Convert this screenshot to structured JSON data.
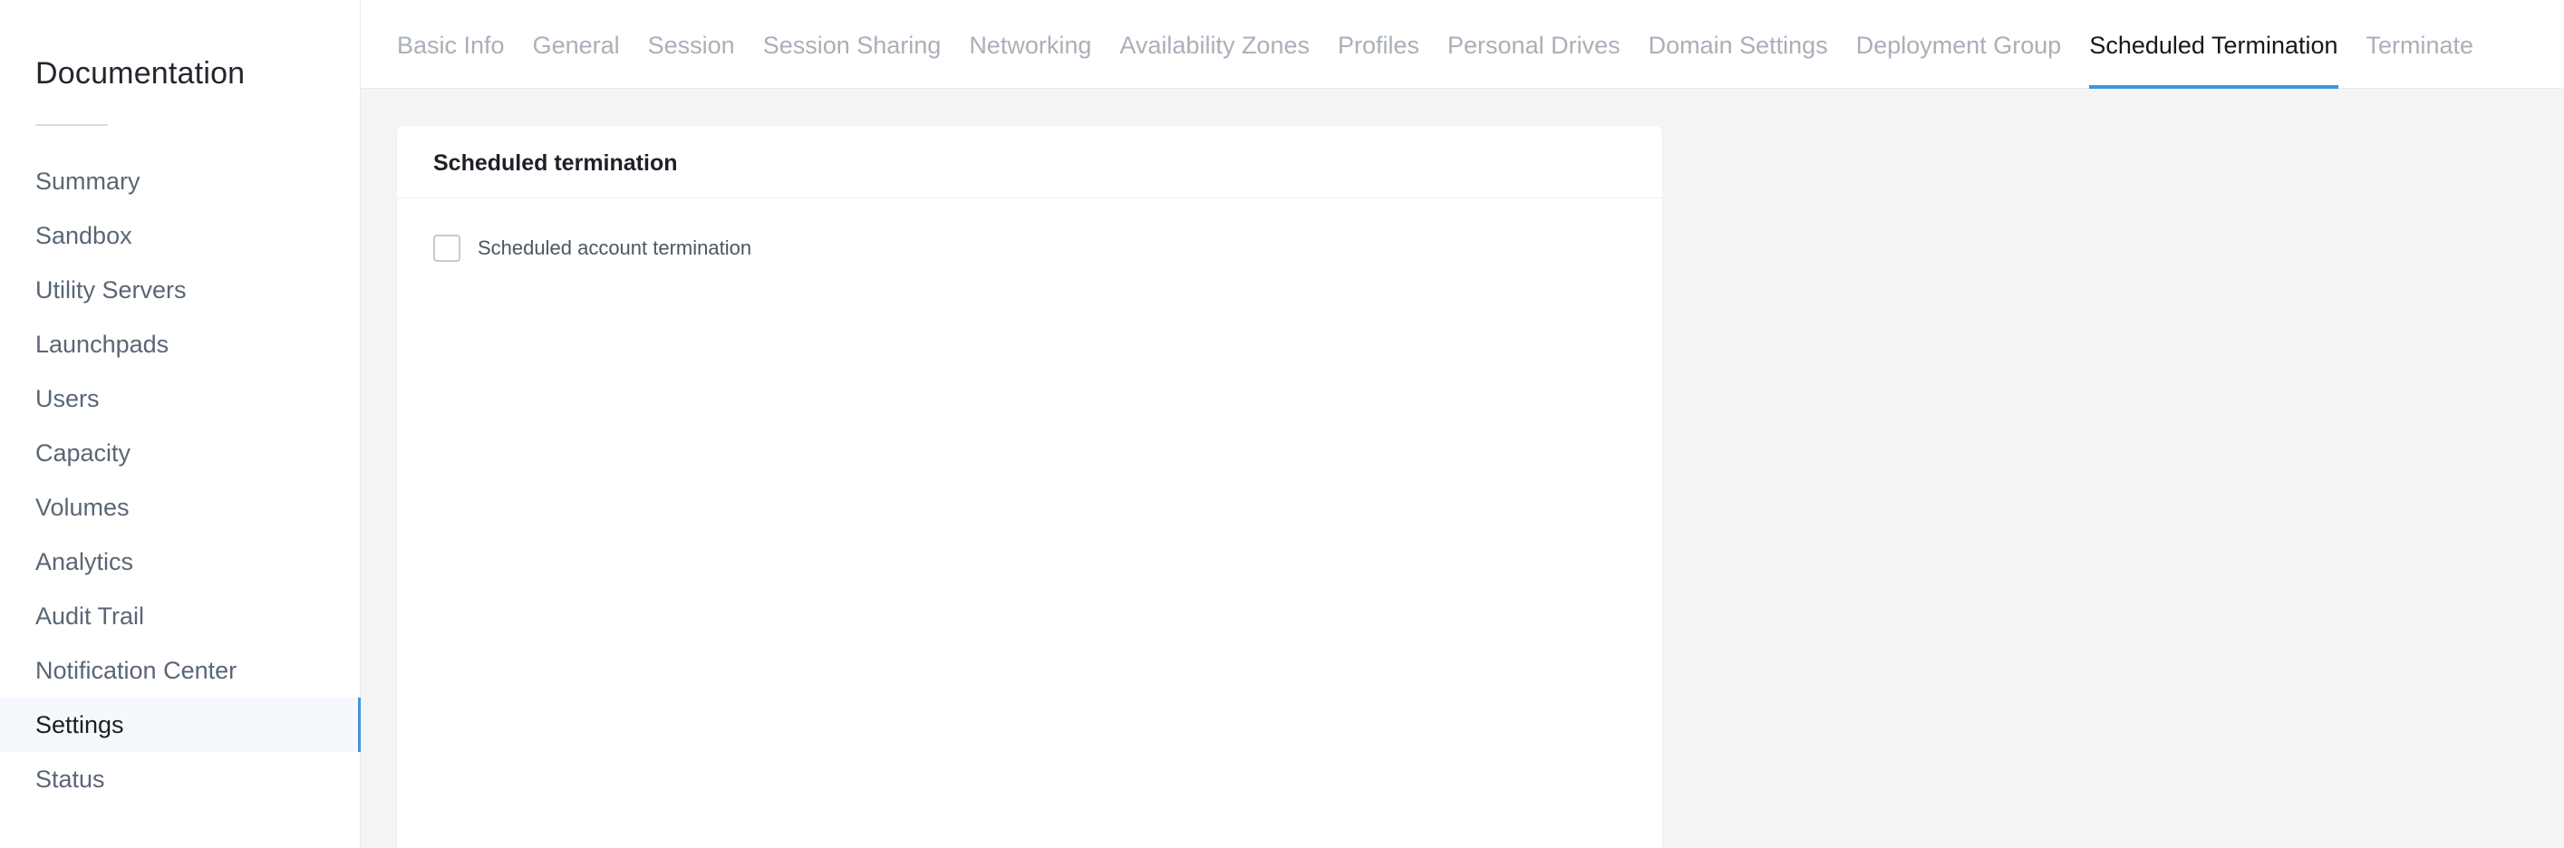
{
  "sidebar": {
    "title": "Documentation",
    "items": [
      {
        "label": "Summary",
        "active": false
      },
      {
        "label": "Sandbox",
        "active": false
      },
      {
        "label": "Utility Servers",
        "active": false
      },
      {
        "label": "Launchpads",
        "active": false
      },
      {
        "label": "Users",
        "active": false
      },
      {
        "label": "Capacity",
        "active": false
      },
      {
        "label": "Volumes",
        "active": false
      },
      {
        "label": "Analytics",
        "active": false
      },
      {
        "label": "Audit Trail",
        "active": false
      },
      {
        "label": "Notification Center",
        "active": false
      },
      {
        "label": "Settings",
        "active": true
      },
      {
        "label": "Status",
        "active": false
      }
    ]
  },
  "tabs": [
    {
      "label": "Basic Info",
      "active": false
    },
    {
      "label": "General",
      "active": false
    },
    {
      "label": "Session",
      "active": false
    },
    {
      "label": "Session Sharing",
      "active": false
    },
    {
      "label": "Networking",
      "active": false
    },
    {
      "label": "Availability Zones",
      "active": false
    },
    {
      "label": "Profiles",
      "active": false
    },
    {
      "label": "Personal Drives",
      "active": false
    },
    {
      "label": "Domain Settings",
      "active": false
    },
    {
      "label": "Deployment Group",
      "active": false
    },
    {
      "label": "Scheduled Termination",
      "active": true
    },
    {
      "label": "Terminate",
      "active": false
    }
  ],
  "card": {
    "title": "Scheduled termination",
    "checkbox_label": "Scheduled account termination",
    "checkbox_checked": false
  },
  "colors": {
    "accent": "#3e95de",
    "page_background": "#f3f4f6"
  }
}
